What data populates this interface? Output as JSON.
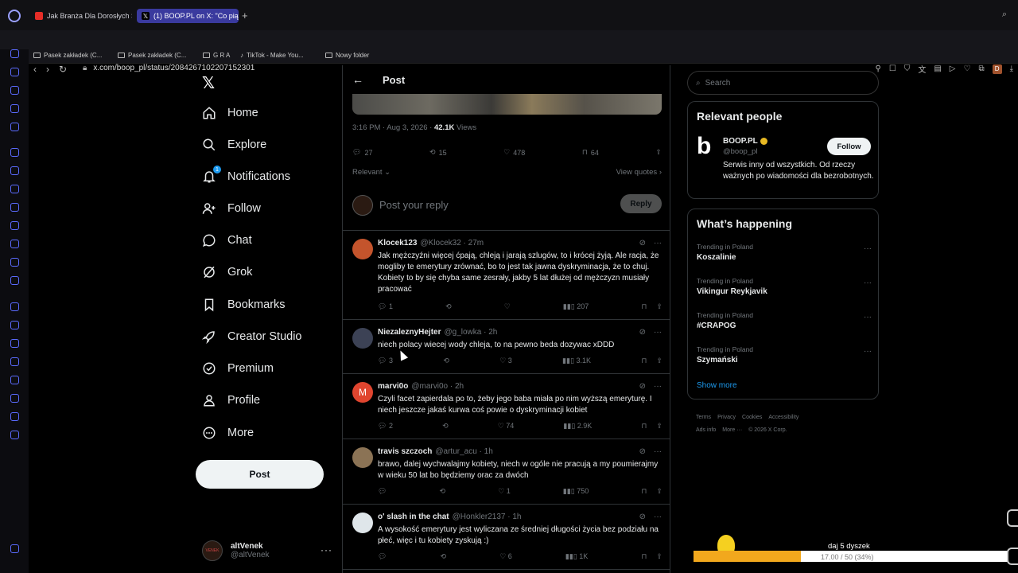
{
  "browser": {
    "tabs": [
      {
        "label": "Jak Branża Dla Dorosłych S"
      },
      {
        "label": "(1) BOOP.PL on X: \"Co piąt"
      }
    ],
    "new_tab": "+",
    "url": "x.com/boop_pl/status/2084267102207152301",
    "bookmarks": [
      {
        "label": "Pasek zakładek (C..."
      },
      {
        "label": "Pasek zakładek (C..."
      },
      {
        "label": "G R A"
      },
      {
        "label": "TikTok - Make You..."
      },
      {
        "label": "Nowy folder"
      }
    ],
    "profile_initial": "D"
  },
  "nav": {
    "items": [
      {
        "label": "Home",
        "icon": "home-icon"
      },
      {
        "label": "Explore",
        "icon": "search-icon"
      },
      {
        "label": "Notifications",
        "icon": "bell-icon",
        "badge": "1"
      },
      {
        "label": "Follow",
        "icon": "person-plus-icon"
      },
      {
        "label": "Chat",
        "icon": "chat-icon"
      },
      {
        "label": "Grok",
        "icon": "grok-icon"
      },
      {
        "label": "Bookmarks",
        "icon": "bookmark-icon"
      },
      {
        "label": "Creator Studio",
        "icon": "rocket-icon"
      },
      {
        "label": "Premium",
        "icon": "verified-icon"
      },
      {
        "label": "Profile",
        "icon": "person-icon"
      },
      {
        "label": "More",
        "icon": "more-circle-icon"
      }
    ],
    "post_label": "Post",
    "account": {
      "name": "altVenek",
      "handle": "@altVenek"
    }
  },
  "post": {
    "header_title": "Post",
    "time": "3:16 PM · Aug 3, 2026 · ",
    "views_value": "42.1K",
    "views_label": " Views",
    "stats": {
      "replies": "27",
      "reposts": "15",
      "likes": "478",
      "bookmarks": "64"
    },
    "sort_label": "Relevant",
    "view_quotes": "View quotes",
    "reply_placeholder": "Post your reply",
    "reply_button": "Reply"
  },
  "replies": [
    {
      "name": "Klocek123",
      "handle": "@Klocek32 · 27m",
      "text": "Jak mężczyźni więcej ćpają, chleją i jarają szlugów, to i krócej żyją. Ale racja, że mogliby te emerytury zrównać, bo to jest tak jawna dyskryminacja, że to chuj. Kobiety to by się chyba same zesrały, jakby 5 lat dłużej od mężczyzn musiały pracować",
      "replies": "1",
      "reposts": "",
      "likes": "",
      "views": "207"
    },
    {
      "name": "NiezaleznyHejter",
      "handle": "@g_lowka · 2h",
      "text": "niech polacy wiecej wody chleja, to na pewno beda dozywac xDDD",
      "replies": "3",
      "reposts": "",
      "likes": "3",
      "views": "3.1K"
    },
    {
      "name": "marvi0o",
      "handle": "@marvi0o · 2h",
      "text": "Czyli facet zapierdala po to, żeby jego baba miała po nim wyższą emeryturę. I niech jeszcze jakaś kurwa coś powie o dyskryminacji kobiet",
      "replies": "2",
      "reposts": "",
      "likes": "74",
      "views": "2.9K"
    },
    {
      "name": "travis szczoch",
      "handle": "@artur_acu · 1h",
      "text": "brawo, dalej wychwalajmy kobiety, niech w ogóle nie pracują a my poumierajmy w wieku 50 lat bo będziemy orac za dwóch",
      "replies": "",
      "reposts": "",
      "likes": "1",
      "views": "750"
    },
    {
      "name": "o' slash in the chat",
      "handle": "@Honkler2137 · 1h",
      "text": "A wysokość emerytury jest wyliczana ze średniej długości życia bez podziału na płeć, więc i tu kobiety zyskują :)",
      "replies": "",
      "reposts": "",
      "likes": "6",
      "views": "1K"
    }
  ],
  "sidebar": {
    "search_placeholder": "Search",
    "relevant_title": "Relevant people",
    "person": {
      "name": "BOOP.PL",
      "handle": "@boop_pl",
      "bio": "Serwis inny od wszystkich. Od rzeczy ważnych po wiadomości dla bezrobotnych.",
      "follow": "Follow",
      "logo": "b"
    },
    "happening_title": "What’s happening",
    "trends": [
      {
        "category": "Trending in Poland",
        "title": "Koszalinie"
      },
      {
        "category": "Trending in Poland",
        "title": "Vikingur Reykjavik"
      },
      {
        "category": "Trending in Poland",
        "title": "#CRAPOG"
      },
      {
        "category": "Trending in Poland",
        "title": "Szymański"
      }
    ],
    "show_more": "Show more",
    "footer": [
      "Terms",
      "Privacy",
      "Cookies",
      "Accessibility",
      "Ads info",
      "More ···",
      "© 2026 X Corp."
    ]
  },
  "overlay": {
    "label": "daj 5 dyszek",
    "count": "17.00 / 50 (34%)",
    "progress_percent": 34,
    "accent": "#f2a81d"
  },
  "colors": {
    "link": "#1d9bf0",
    "muted": "#71767b",
    "border": "#2f3336",
    "tab_active": "#3a3a9e"
  }
}
